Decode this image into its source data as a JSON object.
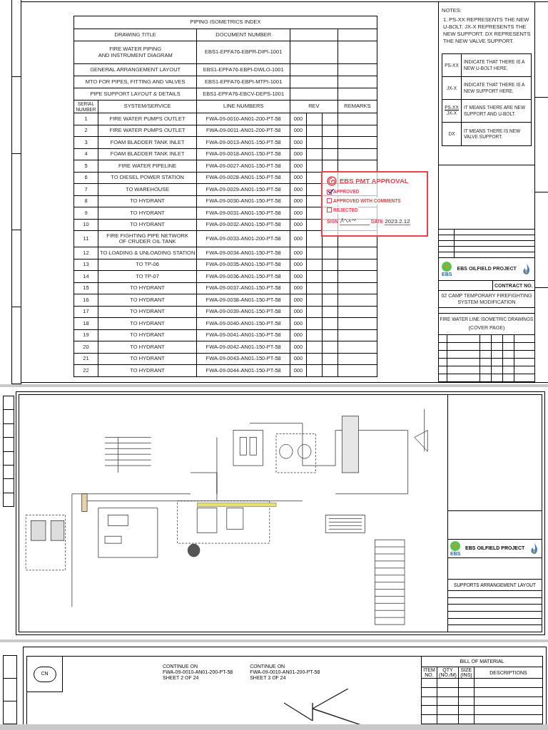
{
  "index_page": {
    "title": "PIPING ISOMETRICS INDEX",
    "doc_header": {
      "title": "DRAWING TITLE",
      "number": "DOCUMENT NUMBER"
    },
    "documents": [
      {
        "title_lines": [
          "FIRE WATER PIPING",
          "AND INSTRUMENT DIAGRAM"
        ],
        "number": "EBS1-EPFA76-EBPR-DIPI-1001"
      },
      {
        "title_lines": [
          "GENERAL ARRANGEMENT LAYOUT"
        ],
        "number": "EBS1-EPFA76-EBPI-DWLO-1001"
      },
      {
        "title_lines": [
          "MTO FOR PIPES, FITTING AND VALVES"
        ],
        "number": "EBS1-EPFA76-EBPI-MTPI-1001"
      },
      {
        "title_lines": [
          "PIPE SUPPORT LAYOUT & DETAILS"
        ],
        "number": "EBS1-EPFA76-EBCV-DEPS-1001"
      }
    ],
    "columns": {
      "serial_lines": [
        "SERIAL",
        "NUMBER"
      ],
      "service": "SYSTEM/SERVICE",
      "line": "LINE NUMBERS",
      "rev": "REV",
      "remarks": "REMARKS"
    },
    "rows": [
      {
        "serial": "1",
        "service_lines": [
          "FIRE WATER PUMPS OUTLET"
        ],
        "line": "FWA-09-0010-AN01-200-PT-58",
        "rev": "000"
      },
      {
        "serial": "2",
        "service_lines": [
          "FIRE WATER PUMPS OUTLET"
        ],
        "line": "FWA-09-0011-AN01-200-PT-58",
        "rev": "000"
      },
      {
        "serial": "3",
        "service_lines": [
          "FOAM BLADDER TANK INLET"
        ],
        "line": "FWA-09-0013-AN01-150-PT-58",
        "rev": "000"
      },
      {
        "serial": "4",
        "service_lines": [
          "FOAM BLADDER TANK INLET"
        ],
        "line": "FWA-09-0018-AN01-150-PT-58",
        "rev": "000"
      },
      {
        "serial": "5",
        "service_lines": [
          "FIRE WATER PIPELINE"
        ],
        "line": "FWA-09-0027-AN01-150-PT-58",
        "rev": "000"
      },
      {
        "serial": "6",
        "service_lines": [
          "TO DIESEL POWER STATION"
        ],
        "line": "FWA-09-0028-AN01-150-PT-58",
        "rev": "000"
      },
      {
        "serial": "7",
        "service_lines": [
          "TO WAREHOUSE"
        ],
        "line": "FWA-09-0029-AN01-150-PT-58",
        "rev": "000"
      },
      {
        "serial": "8",
        "service_lines": [
          "TO HYDRANT"
        ],
        "line": "FWA-09-0030-AN01-150-PT-58",
        "rev": "000"
      },
      {
        "serial": "9",
        "service_lines": [
          "TO HYDRANT"
        ],
        "line": "FWA-09-0031-AN01-150-PT-58",
        "rev": "000"
      },
      {
        "serial": "10",
        "service_lines": [
          "TO HYDRANT"
        ],
        "line": "FWA-09-0032-AN01-150-PT-58",
        "rev": "000"
      },
      {
        "serial": "11",
        "service_lines": [
          "FIRE FIGHTING PIPE NETWORK",
          "OF CRUDER OIL TANK"
        ],
        "line": "FWA-09-0033-AN01-200-PT-58",
        "rev": "000"
      },
      {
        "serial": "12",
        "service_lines": [
          "TO LOADING & UNLOADING STATION"
        ],
        "line": "FWA-09-0034-AN01-150-PT-58",
        "rev": "000"
      },
      {
        "serial": "13",
        "service_lines": [
          "TO TP-06"
        ],
        "line": "FWA-09-0035-AN01-150-PT-58",
        "rev": "000"
      },
      {
        "serial": "14",
        "service_lines": [
          "TO TP-07"
        ],
        "line": "FWA-09-0036-AN01-150-PT-58",
        "rev": "000"
      },
      {
        "serial": "15",
        "service_lines": [
          "TO HYDRANT"
        ],
        "line": "FWA-09-0037-AN01-150-PT-58",
        "rev": "000"
      },
      {
        "serial": "16",
        "service_lines": [
          "TO HYDRANT"
        ],
        "line": "FWA-09-0038-AN01-150-PT-58",
        "rev": "000"
      },
      {
        "serial": "17",
        "service_lines": [
          "TO HYDRANT"
        ],
        "line": "FWA-09-0039-AN01-150-PT-58",
        "rev": "000"
      },
      {
        "serial": "18",
        "service_lines": [
          "TO HYDRANT"
        ],
        "line": "FWA-09-0040-AN01-150-PT-58",
        "rev": "000"
      },
      {
        "serial": "19",
        "service_lines": [
          "TO HYDRANT"
        ],
        "line": "FWA-09-0041-AN01-150-PT-58",
        "rev": "000"
      },
      {
        "serial": "20",
        "service_lines": [
          "TO HYDRANT"
        ],
        "line": "FWA-09-0042-AN01-150-PT-58",
        "rev": "000"
      },
      {
        "serial": "21",
        "service_lines": [
          "TO HYDRANT"
        ],
        "line": "FWA-09-0043-AN01-150-PT-58",
        "rev": "000"
      },
      {
        "serial": "22",
        "service_lines": [
          "TO HYDRANT"
        ],
        "line": "FWA-09-0044-AN01-150-PT-58",
        "rev": "000"
      }
    ],
    "notes": {
      "heading": "NOTES:",
      "text": "1. PS-XX REPRESENTS THE NEW U-BOLT. JX-X REPRESENTS THE NEW SUPPORT. DX REPRESENTS THE NEW VALVE SUPPORT."
    },
    "legend": [
      {
        "kind": "single",
        "symbol": "PS-XX",
        "meaning": "INDICATE THAT THERE IS A NEW U-BOLT HERE."
      },
      {
        "kind": "single",
        "symbol": "JX-X",
        "meaning": "INDICATE THAT THERE IS A NEW SUPPORT HERE."
      },
      {
        "kind": "fraction",
        "symbol_top": "PS-XX",
        "symbol_bottom": "JX-X",
        "meaning": "IT MEANS THERE ARE NEW SUPPORT AND U-BOLT."
      },
      {
        "kind": "single",
        "symbol": "DX",
        "meaning": "IT MEANS THERE IS NEW VALVE SUPPORT."
      }
    ],
    "stamp": {
      "title": "EBS PMT APPROVAL",
      "options": [
        {
          "label": "APPROVED",
          "checked": true
        },
        {
          "label": "APPROVED WITH COMMENTS",
          "checked": false
        },
        {
          "label": "REJECTED",
          "checked": false
        }
      ],
      "sign_label": "SIGN",
      "date_label": "DATE",
      "date": "2023.2.12"
    },
    "title_block": {
      "logo_text": "EBS",
      "project": "EBS OILFIELD PROJECT",
      "contract_label": "CONTRACT NO.",
      "project_title": "02 CAMP TEMPORARY FIREFIGHTING SYSTEM MODIFICATION",
      "drawing_title": "FIRE WATER LINE ISOMETRIC DRAWINGS",
      "drawing_subtitle": "(COVER PAGE)"
    }
  },
  "layout_page": {
    "logo_text": "EBS",
    "project": "EBS OILFIELD PROJECT",
    "drawing_title": "SUPPORTS ARRANGEMENT LAYOUT"
  },
  "isometric_page": {
    "symbol": "CN",
    "continuations": [
      {
        "lines": [
          "CONTINUE ON",
          "FWA-09-0010-AN01-200-PT-58",
          "SHEET 2 OF 24"
        ]
      },
      {
        "lines": [
          "CONTINUE ON",
          "FWA-09-0010-AN01-200-PT-58",
          "SHEET 3 OF 24"
        ]
      }
    ],
    "bom": {
      "title": "BILL OF MATERIAL",
      "columns": [
        {
          "lines": [
            "ITEM",
            "NO."
          ]
        },
        {
          "lines": [
            "QTY",
            "(NO./M)"
          ]
        },
        {
          "lines": [
            "SIZE",
            "(INS)"
          ]
        },
        {
          "lines": [
            "DESCRIPTIONS"
          ]
        }
      ]
    }
  }
}
